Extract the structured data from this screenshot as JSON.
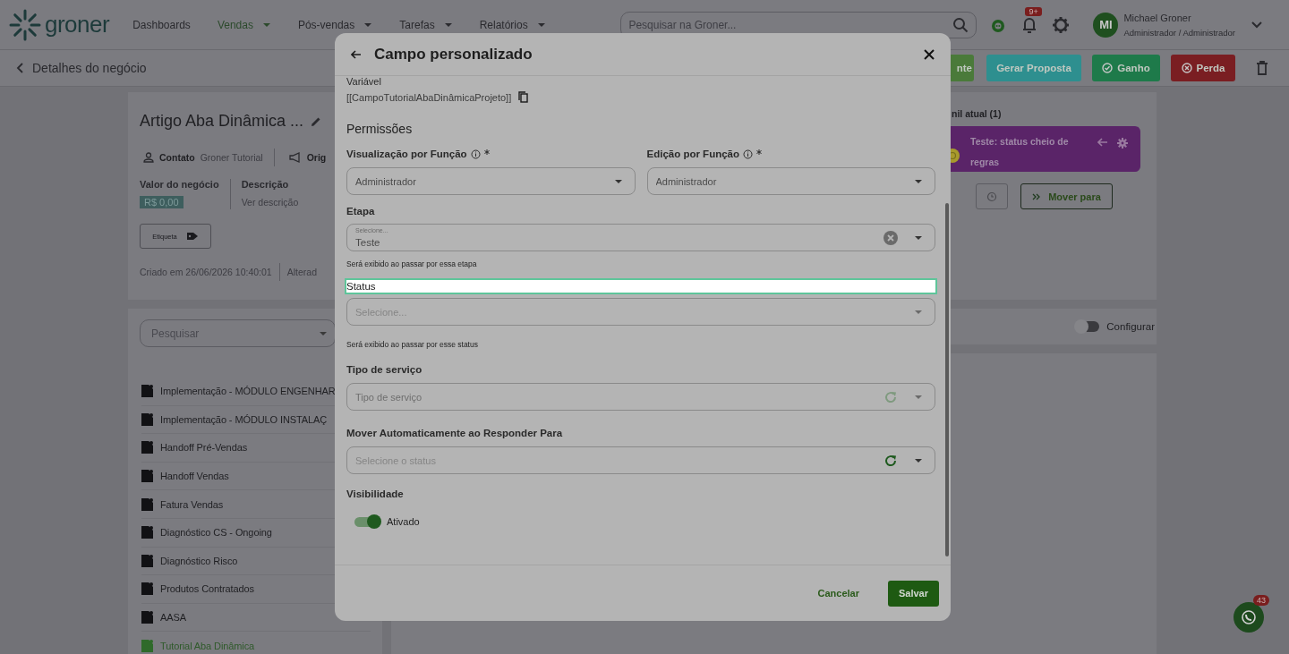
{
  "header": {
    "logo": "groner",
    "nav": [
      {
        "label": "Dashboards",
        "selected": false,
        "dropdown": false
      },
      {
        "label": "Vendas",
        "selected": true,
        "dropdown": true
      },
      {
        "label": "Pós-vendas",
        "selected": false,
        "dropdown": true
      },
      {
        "label": "Tarefas",
        "selected": false,
        "dropdown": true
      },
      {
        "label": "Relatórios",
        "selected": false,
        "dropdown": true
      }
    ],
    "search": {
      "placeholder": "Pesquisar na Groner..."
    },
    "notifications_badge": "9+",
    "user": {
      "initials": "MI",
      "name": "Michael Groner",
      "role": "Administrador / Administrador"
    }
  },
  "subheader": {
    "back_label": "Detalhes do negócio",
    "actions": [
      {
        "label": "nte",
        "kind": "plain"
      },
      {
        "label": "Gerar Proposta",
        "kind": "proposal"
      },
      {
        "label": "Ganho",
        "kind": "won"
      },
      {
        "label": "Perda",
        "kind": "lost"
      }
    ]
  },
  "deal": {
    "title": "Artigo Aba Dinâmica ...",
    "contact_label": "Contato",
    "contact_value": "Groner Tutorial",
    "origin_label": "Orig",
    "value_label": "Valor do negócio",
    "value": "R$ 0,00",
    "description_label": "Descrição",
    "description_link": "Ver descrição",
    "tag_button": "Etiqueta",
    "created": "Criado em 26/06/2026 10:40:01",
    "altered": "Alterad"
  },
  "tabs_panel": {
    "search_placeholder": "Pesquisar",
    "items": [
      {
        "label": "Implementação - MÓDULO ENGENHAR",
        "selected": false
      },
      {
        "label": "Implementação - MÓDULO INSTALAÇ",
        "selected": false
      },
      {
        "label": "Handoff Pré-Vendas",
        "selected": false
      },
      {
        "label": "Handoff Vendas",
        "selected": false
      },
      {
        "label": "Fatura Vendas",
        "selected": false
      },
      {
        "label": "Diagnóstico CS - Ongoing",
        "selected": false
      },
      {
        "label": "Diagnóstico Risco",
        "selected": false
      },
      {
        "label": "Produtos Contratados",
        "selected": false
      },
      {
        "label": "AASA",
        "selected": false
      },
      {
        "label": "Tutorial Aba Dinâmica",
        "selected": true
      }
    ]
  },
  "funnel": {
    "heading": "nil atual (1)",
    "status": {
      "label": "Teste: status cheio de regras",
      "color": "#5a2468"
    },
    "move_button": "Mover para"
  },
  "configure": {
    "label": "Configurar",
    "on": false
  },
  "modal": {
    "title": "Campo personalizado",
    "variable_label": "Variável",
    "variable_value": "[[CampoTutorialAbaDinâmicaProjeto]]",
    "section": "Permissões",
    "role_fields": [
      {
        "label": "Visualização por Função",
        "required": true,
        "value": "Administrador"
      },
      {
        "label": "Edição por Função",
        "required": true,
        "value": "Administrador"
      }
    ],
    "fields": [
      {
        "kind": "clearable",
        "label": "Etapa",
        "highlighted": false,
        "floating_label": "Selecione...",
        "value": "Teste",
        "hint": "Será exibido ao passar por essa etapa"
      },
      {
        "kind": "select",
        "label": "Status",
        "highlighted": true,
        "placeholder": "Selecione...",
        "hint": "Será exibido ao passar por esse status"
      },
      {
        "kind": "refresh",
        "label": "Tipo de serviço",
        "highlighted": false,
        "placeholder": "Tipo de serviço",
        "disabled": true
      },
      {
        "kind": "refresh",
        "label": "Mover Automaticamente ao Responder Para",
        "highlighted": false,
        "placeholder": "Selecione o status",
        "disabled": false
      }
    ],
    "visibility": {
      "label": "Visibilidade",
      "toggle_label": "Ativado",
      "on": true
    },
    "cancel": "Cancelar",
    "save": "Salvar"
  },
  "chat_badge": "43"
}
